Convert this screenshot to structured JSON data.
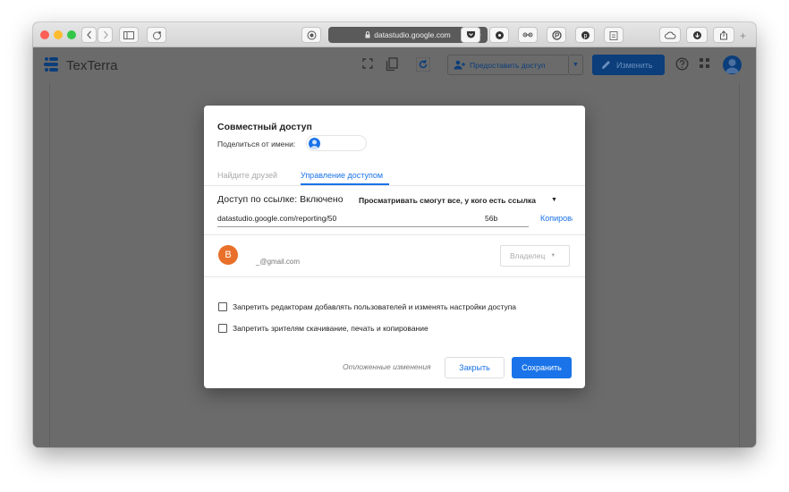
{
  "browser": {
    "url": "datastudio.google.com",
    "new_tab_symbol": "+"
  },
  "app": {
    "brand": "TexTerra",
    "share_label": "Предоставить доступ",
    "edit_label": "Изменить"
  },
  "dialog": {
    "title": "Совместный доступ",
    "share_as_label": "Поделиться от имени:",
    "tabs": {
      "find_friends": "Найдите друзей",
      "manage_access": "Управление доступом"
    },
    "link_access": {
      "label": "Доступ по ссылке: Включено",
      "selected_option": "Просматривать смогут все, у кого есть ссылка",
      "url": "datastudio.google.com/reporting/50",
      "url_suffix": "56b",
      "copy_label": "Копировать"
    },
    "user": {
      "initial": "B",
      "email": "_@gmail.com",
      "role": "Владелец"
    },
    "options": [
      {
        "label": "Запретить редакторам добавлять пользователей и изменять настройки доступа",
        "checked": false
      },
      {
        "label": "Запретить зрителям скачивание, печать и копирование",
        "checked": false
      }
    ],
    "pending_changes": "Отложенные изменения",
    "close_label": "Закрыть",
    "save_label": "Сохранить"
  },
  "colors": {
    "accent": "#1a73e8",
    "avatar_user": "#e8702a",
    "app_accent_dimmed": "#0b3e7a"
  }
}
